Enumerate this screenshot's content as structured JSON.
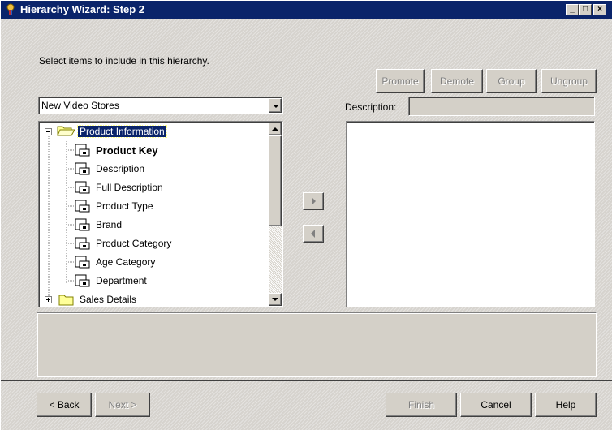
{
  "window": {
    "title": "Hierarchy Wizard: Step 2",
    "controls": {
      "minimize": "_",
      "maximize": "□",
      "close": "×"
    }
  },
  "instructions": "Select items to include in this hierarchy.",
  "toolbar": {
    "promote": {
      "label": "Promote",
      "enabled": false
    },
    "demote": {
      "label": "Demote",
      "enabled": false
    },
    "group": {
      "label": "Group",
      "enabled": false
    },
    "ungroup": {
      "label": "Ungroup",
      "enabled": false
    }
  },
  "source_select": {
    "value": "New Video Stores"
  },
  "tree": {
    "folders": [
      {
        "label": "Product Information",
        "expanded": true,
        "selected": true,
        "icon": "open-folder-icon",
        "items": [
          {
            "label": "Product Key",
            "bold": true,
            "icon": "key-field-icon"
          },
          {
            "label": "Description",
            "icon": "field-icon"
          },
          {
            "label": "Full Description",
            "icon": "field-icon"
          },
          {
            "label": "Product Type",
            "icon": "field-icon"
          },
          {
            "label": "Brand",
            "icon": "field-icon"
          },
          {
            "label": "Product Category",
            "icon": "field-icon"
          },
          {
            "label": "Age Category",
            "icon": "field-icon"
          },
          {
            "label": "Department",
            "icon": "field-icon"
          }
        ]
      },
      {
        "label": "Sales Details",
        "expanded": false,
        "icon": "closed-folder-icon"
      }
    ]
  },
  "move_buttons": {
    "add": "add-arrow-icon",
    "remove": "remove-arrow-icon"
  },
  "description": {
    "label": "Description:",
    "value": ""
  },
  "buttons": {
    "back": {
      "label": "< Back",
      "enabled": true
    },
    "next": {
      "label": "Next >",
      "enabled": false
    },
    "finish": {
      "label": "Finish",
      "enabled": false
    },
    "cancel": {
      "label": "Cancel",
      "enabled": true
    },
    "help": {
      "label": "Help",
      "enabled": true
    }
  },
  "colors": {
    "titlebar": "#0a246a",
    "face": "#d4d0c8",
    "selection": "#0a246a"
  }
}
